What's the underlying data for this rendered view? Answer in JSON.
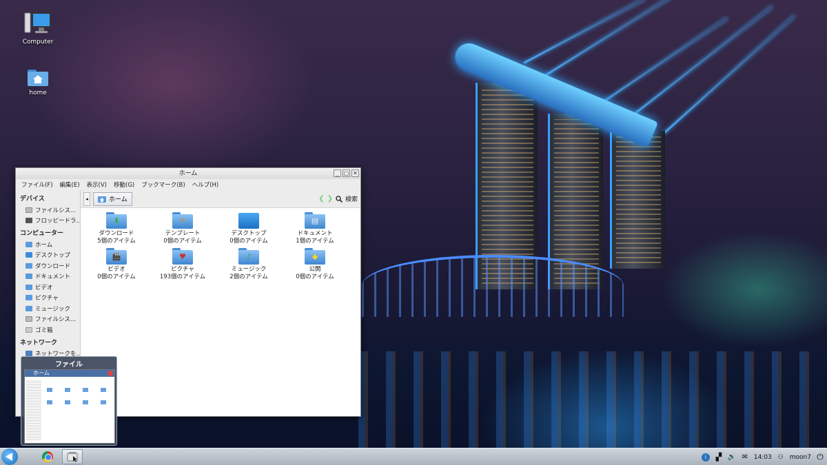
{
  "desktop": {
    "icons": [
      {
        "label": "Computer",
        "icon": "computer-icon"
      },
      {
        "label": "home",
        "icon": "home-folder-icon"
      }
    ]
  },
  "window": {
    "title": "ホーム",
    "controls": {
      "minimize": "_",
      "maximize": "□",
      "close": "✕"
    },
    "menu": [
      "ファイル(F)",
      "編集(E)",
      "表示(V)",
      "移動(G)",
      "ブックマーク(B)",
      "ヘルプ(H)"
    ],
    "location": {
      "current": "ホーム",
      "search": "検索"
    },
    "sidebar": {
      "sections": [
        {
          "heading": "デバイス",
          "items": [
            "ファイルシス...",
            "フロッピードラ..."
          ]
        },
        {
          "heading": "コンピューター",
          "items": [
            "ホーム",
            "デスクトップ",
            "ダウンロード",
            "ドキュメント",
            "ビデオ",
            "ピクチャ",
            "ミュージック",
            "ファイルシス...",
            "ゴミ箱"
          ]
        },
        {
          "heading": "ネットワーク",
          "items": [
            "ネットワークを..."
          ]
        }
      ]
    },
    "files": [
      {
        "name": "ダウンロード",
        "count": "5個のアイテム",
        "icon": "download-folder-icon"
      },
      {
        "name": "テンプレート",
        "count": "0個のアイテム",
        "icon": "templates-folder-icon"
      },
      {
        "name": "デスクトップ",
        "count": "0個のアイテム",
        "icon": "desktop-folder-icon"
      },
      {
        "name": "ドキュメント",
        "count": "1個のアイテム",
        "icon": "documents-folder-icon"
      },
      {
        "name": "ビデオ",
        "count": "0個のアイテム",
        "icon": "videos-folder-icon"
      },
      {
        "name": "ピクチャ",
        "count": "193個のアイテム",
        "icon": "pictures-folder-icon"
      },
      {
        "name": "ミュージック",
        "count": "2個のアイテム",
        "icon": "music-folder-icon"
      },
      {
        "name": "公開",
        "count": "0個のアイテム",
        "icon": "public-folder-icon"
      }
    ]
  },
  "preview": {
    "title": "ファイル",
    "window_title": "ホーム"
  },
  "panel": {
    "clock": "14:03",
    "user": "moon7"
  }
}
